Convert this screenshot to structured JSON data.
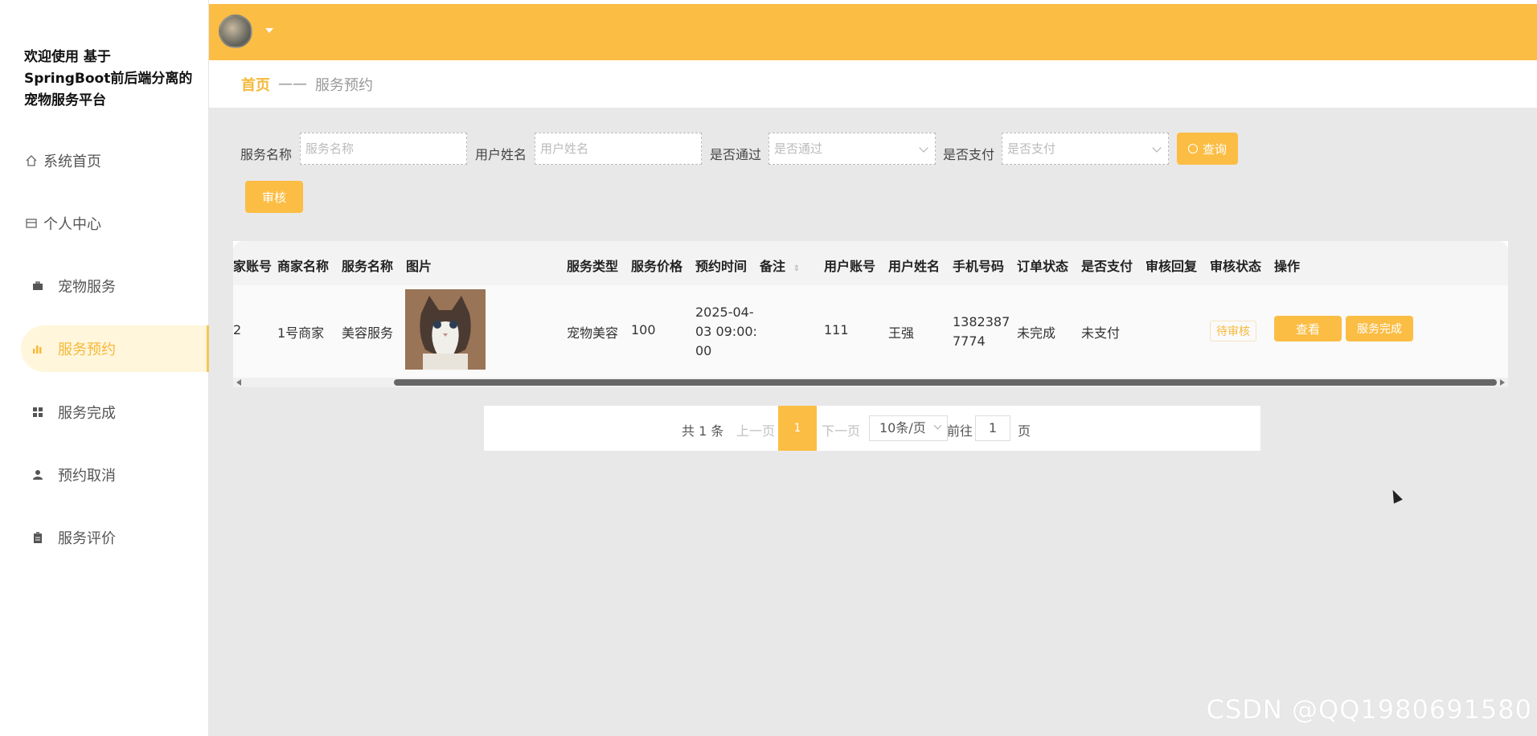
{
  "sidebar": {
    "brand": "欢迎使用 基于SpringBoot前后端分离的宠物服务平台",
    "items": [
      {
        "label": "系统首页",
        "icon": "home-icon"
      },
      {
        "label": "个人中心",
        "icon": "card-icon"
      },
      {
        "label": "宠物服务",
        "icon": "briefcase-icon"
      },
      {
        "label": "服务预约",
        "icon": "bar-chart-icon"
      },
      {
        "label": "服务完成",
        "icon": "grid-icon"
      },
      {
        "label": "预约取消",
        "icon": "user-icon"
      },
      {
        "label": "服务评价",
        "icon": "clipboard-icon"
      }
    ],
    "active_index": 3
  },
  "breadcrumb": {
    "home": "首页",
    "separator": "——",
    "current": "服务预约"
  },
  "filters": {
    "service_name": {
      "label": "服务名称",
      "placeholder": "服务名称"
    },
    "user_name": {
      "label": "用户姓名",
      "placeholder": "用户姓名"
    },
    "approved": {
      "label": "是否通过",
      "placeholder": "是否通过"
    },
    "paid": {
      "label": "是否支付",
      "placeholder": "是否支付"
    },
    "query_label": "查询",
    "audit_label": "审核"
  },
  "table": {
    "headers": [
      "家账号",
      "商家名称",
      "服务名称",
      "图片",
      "服务类型",
      "服务价格",
      "预约时间",
      "备注",
      "用户账号",
      "用户姓名",
      "手机号码",
      "订单状态",
      "是否支付",
      "审核回复",
      "审核状态",
      "操作"
    ],
    "rows": [
      {
        "merchant_account": "2",
        "merchant_name": "1号商家",
        "service_name": "美容服务",
        "service_type": "宠物美容",
        "price": "100",
        "time_l1": "2025-04-",
        "time_l2": "03 09:00:",
        "time_l3": "00",
        "user_account": "111",
        "user_name": "王强",
        "phone_l1": "1382387",
        "phone_l2": "7774",
        "order_status": "未完成",
        "paid": "未支付",
        "audit_status": "待审核",
        "view_label": "查看",
        "complete_label": "服务完成"
      }
    ]
  },
  "pagination": {
    "total": "共 1 条",
    "prev": "上一页",
    "current": "1",
    "next": "下一页",
    "page_size": "10条/页",
    "goto_label": "前往",
    "goto_value": "1",
    "page_suffix": "页"
  },
  "watermark": "CSDN @QQ1980691580",
  "colors": {
    "accent": "#fbbd44",
    "active_bg": "#fff6dc"
  }
}
